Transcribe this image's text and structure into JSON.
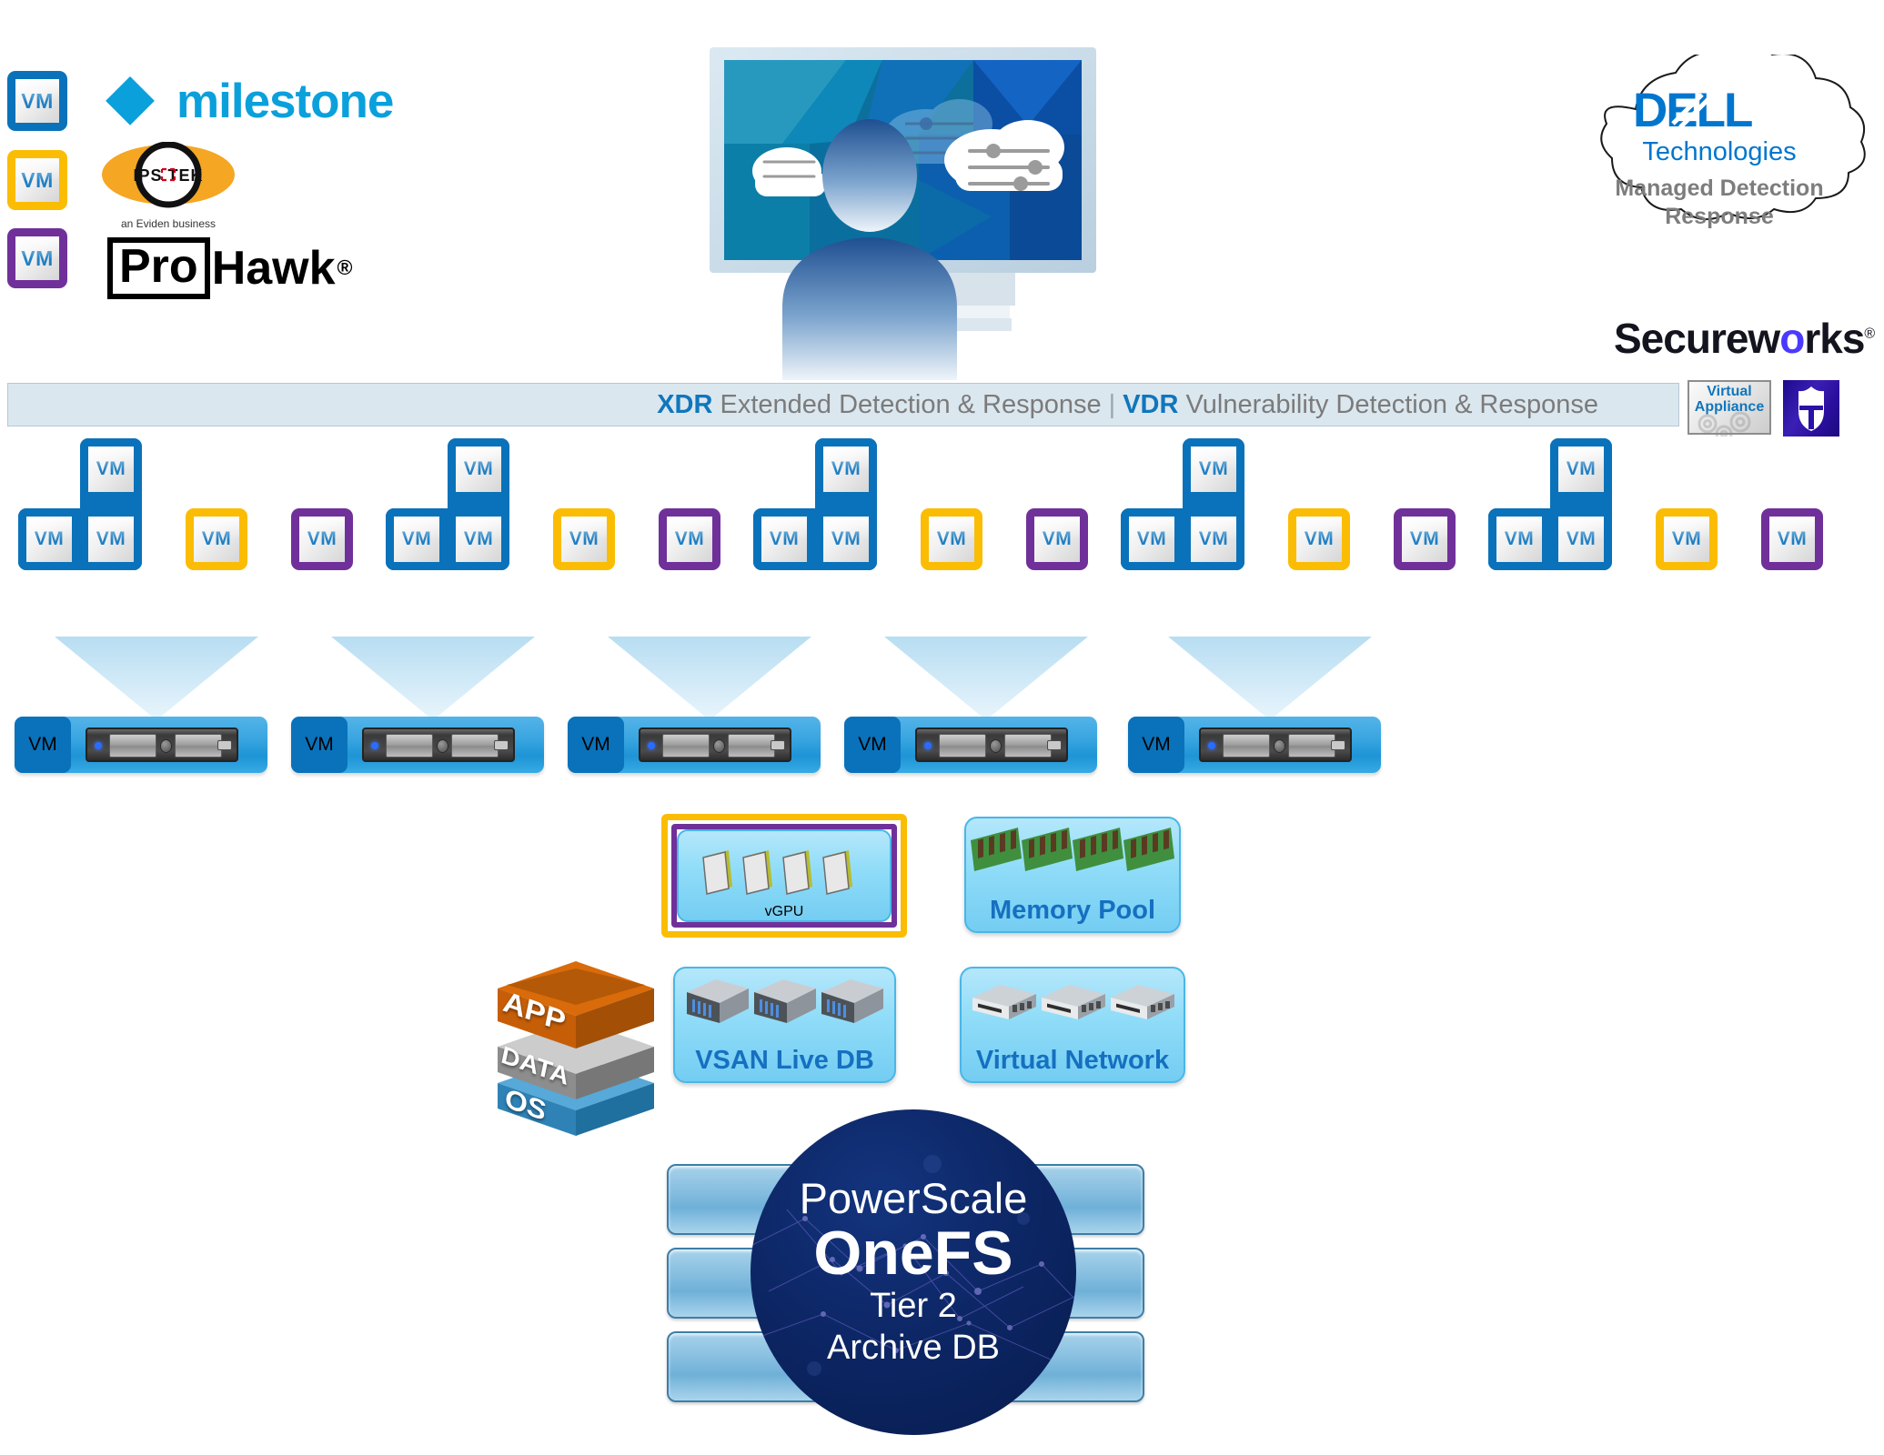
{
  "legend": {
    "vendors": [
      {
        "vm_label": "VM",
        "color": "#0a72ba",
        "name": "milestone",
        "type": "text-logo"
      },
      {
        "vm_label": "VM",
        "color": "#fbbc04",
        "name": "IPSOTEK",
        "caption": "an Eviden business",
        "type": "ipsotek-logo"
      },
      {
        "vm_label": "VM",
        "color": "#70309a",
        "name": "ProHawk",
        "boxed_part": "Pro",
        "rest_part": "Hawk",
        "registered": "®",
        "type": "prohawk-logo"
      }
    ]
  },
  "operator": {
    "alt": "security operator viewing monitoring dashboard on monitor"
  },
  "cloud": {
    "brand": "D∕LL",
    "brand_plain": "DELL",
    "sub": "Technologies",
    "line1": "Managed Detection",
    "line2": "Response",
    "partner": "Secureworks",
    "partner_registered": "®"
  },
  "banner": {
    "xdr_abbr": "XDR",
    "xdr_text": "Extended Detection & Response",
    "separator": "|",
    "vdr_abbr": "VDR",
    "vdr_text": "Vulnerability Detection & Response",
    "accent_color": "#1076bc",
    "text_color": "#7b7b7b",
    "bg_color": "#dbe7ef"
  },
  "virtual_appliance": {
    "line1": "Virtual",
    "line2": "Appliance",
    "icon": "gears-icon",
    "shield_icon": "shield-t-icon"
  },
  "vm_rows": {
    "vm_label": "VM",
    "group_count": 5,
    "group_pattern": [
      "blue-cluster-3",
      "yellow-single",
      "purple-single"
    ],
    "colors": {
      "blue": "#0a72ba",
      "yellow": "#fbbc04",
      "purple": "#70309a"
    }
  },
  "servers": {
    "count": 5,
    "vm_label": "VM"
  },
  "resources": [
    {
      "id": "vgpu",
      "label": "vGPU",
      "icon": "gpu-chip-icon",
      "outer_border": "#fbbc04",
      "inner_border": "#70309a"
    },
    {
      "id": "memory-pool",
      "label": "Memory Pool",
      "icon": "memory-dimm-icon"
    },
    {
      "id": "vsan-live-db",
      "label": "VSAN Live DB",
      "icon": "server-chassis-icon"
    },
    {
      "id": "virtual-network",
      "label": "Virtual Network",
      "icon": "network-switch-icon"
    }
  ],
  "stack": {
    "layers": [
      {
        "label": "APP",
        "color": "#e2700d"
      },
      {
        "label": "DATA",
        "color": "#9a9a9a"
      },
      {
        "label": "OS",
        "color": "#2e8fc4"
      }
    ]
  },
  "storage": {
    "title": "PowerScale",
    "product": "OneFS",
    "tier": "Tier 2",
    "role": "Archive DB",
    "brick_count": 3
  }
}
